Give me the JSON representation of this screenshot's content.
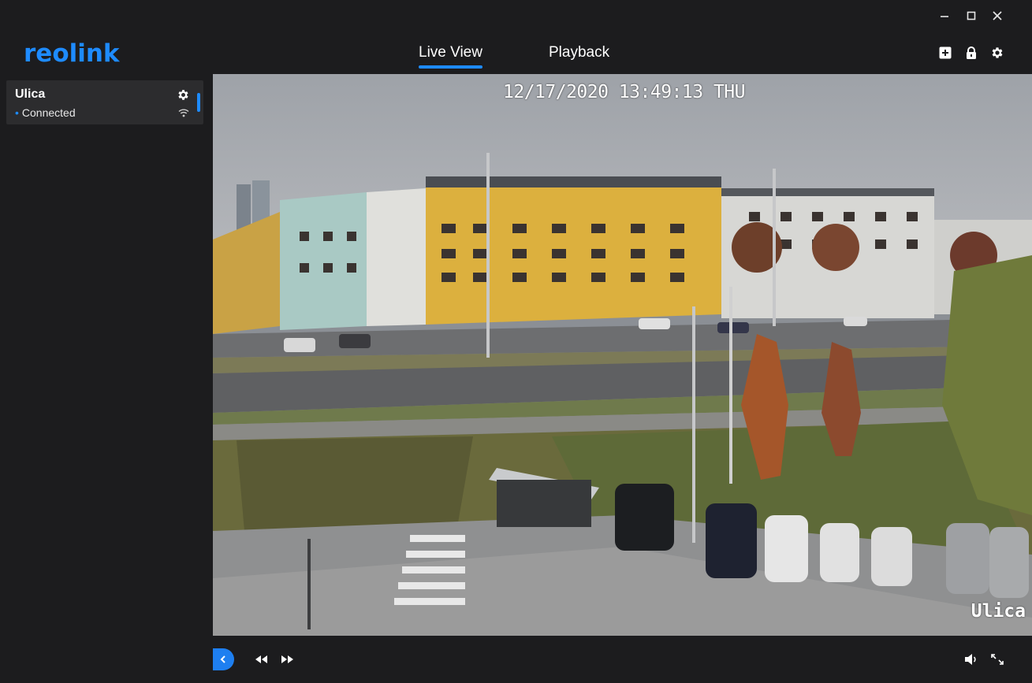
{
  "app": {
    "logo_text": "reolink",
    "accent_color": "#1e8bff"
  },
  "window_controls": [
    "minimize-icon",
    "maximize-icon",
    "close-icon"
  ],
  "nav": {
    "tabs": [
      {
        "label": "Live View",
        "active": true
      },
      {
        "label": "Playback",
        "active": false
      }
    ]
  },
  "toolbar_icons": [
    "add-device-icon",
    "lock-icon",
    "settings-icon"
  ],
  "sidebar": {
    "cameras": [
      {
        "name": "Ulica",
        "status": "Connected",
        "icons": [
          "settings-icon",
          "wifi-icon"
        ]
      }
    ]
  },
  "video": {
    "timestamp": "12/17/2020 13:49:13 THU",
    "camera_label": "Ulica"
  },
  "bottom_controls": [
    "collapse-icon",
    "rewind-icon",
    "fast-forward-icon",
    "volume-icon",
    "fullscreen-icon"
  ]
}
